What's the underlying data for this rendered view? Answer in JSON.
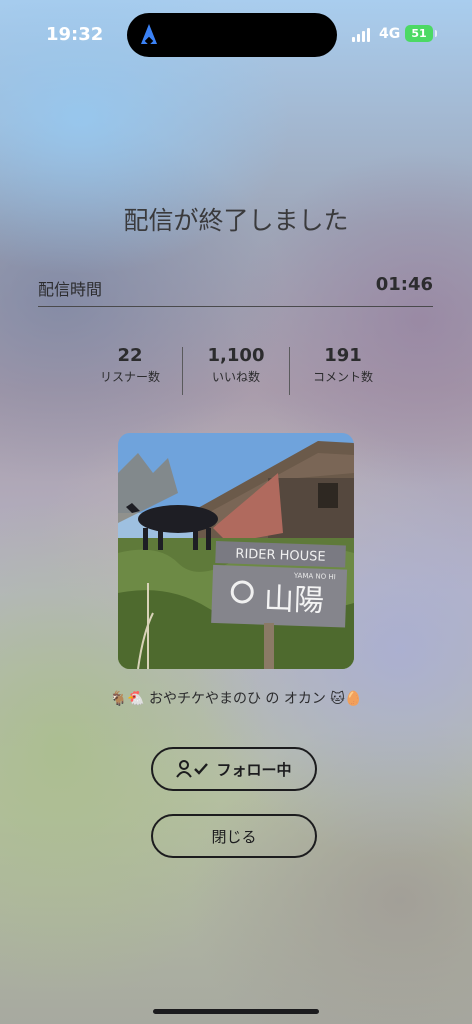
{
  "status_bar": {
    "time": "19:32",
    "network": "4G",
    "battery": "51",
    "icons": [
      "location-arrow-icon",
      "signal-icon",
      "battery-icon"
    ]
  },
  "summary": {
    "title": "配信が終了しました",
    "duration_label": "配信時間",
    "duration_value": "01:46"
  },
  "stats": [
    {
      "value": "22",
      "label": "リスナー数"
    },
    {
      "value": "1,100",
      "label": "いいね数"
    },
    {
      "value": "191",
      "label": "コメント数"
    }
  ],
  "host": {
    "name": "🐐🐔 おやチケやまのひ の オカン 🐱🥚",
    "photo_sign_text": "RIDER HOUSE",
    "photo_sign_sub": "YAMA NO HI",
    "photo_sign_kanji": "山陽"
  },
  "buttons": {
    "follow_label": "フォロー中",
    "close_label": "閉じる"
  },
  "colors": {
    "accent_blue": "#3b82f6",
    "battery_green": "#4cd964",
    "button_border": "#1c1c1e"
  }
}
